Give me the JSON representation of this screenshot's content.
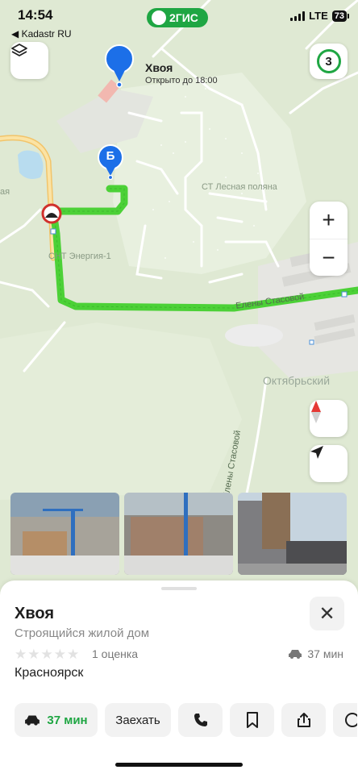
{
  "status": {
    "time": "14:54",
    "back_app": "◀ Kadastr RU",
    "network": "LTE",
    "battery": "73"
  },
  "brand": {
    "label": "2ГИС",
    "color": "#1fa643"
  },
  "map": {
    "traffic_level": "3",
    "zoom_in": "+",
    "zoom_out": "−",
    "place_title": "Хвоя",
    "place_hours": "Открыто до 18:00",
    "route_marker_b": "Б",
    "labels": {
      "lesnaya": "СТ Лесная поляна",
      "energy": "СНТ Энергия-1",
      "street1": "Елены Стасовой",
      "street2": "Елены Стасовой",
      "district": "Октябрьский",
      "edge": "ая"
    },
    "route_color": "#4cd137"
  },
  "photos": [
    "construction-photo-1",
    "construction-photo-2",
    "construction-photo-3"
  ],
  "sheet": {
    "title": "Хвоя",
    "subtitle": "Строящийся жилой дом",
    "stars": [
      "★",
      "★",
      "★",
      "★",
      "★"
    ],
    "rating_count": "1 оценка",
    "drive_time": "37 мин",
    "city": "Красноярск",
    "close": "✕"
  },
  "actions": {
    "route_time": "37 мин",
    "go_label": "Заехать"
  }
}
